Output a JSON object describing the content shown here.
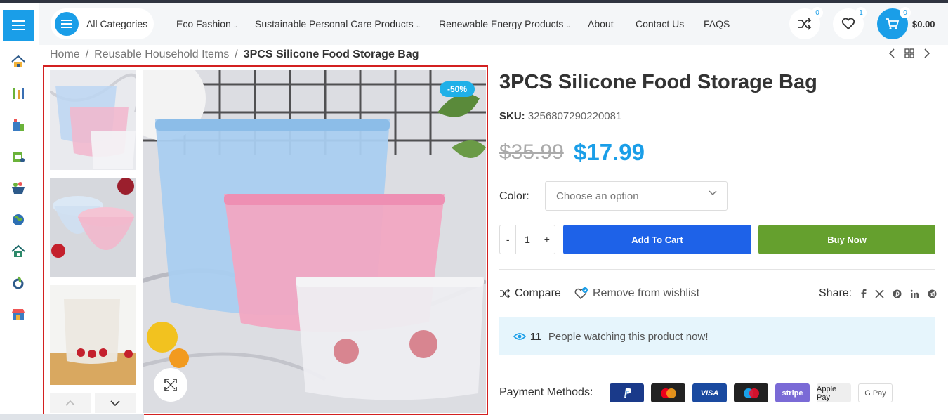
{
  "header": {
    "all_categories": "All Categories",
    "nav": [
      {
        "label": "Eco Fashion",
        "dropdown": true
      },
      {
        "label": "Sustainable Personal Care Products",
        "dropdown": true
      },
      {
        "label": "Renewable Energy Products",
        "dropdown": true
      },
      {
        "label": "About",
        "dropdown": false
      },
      {
        "label": "Contact Us",
        "dropdown": false
      },
      {
        "label": "FAQS",
        "dropdown": false
      }
    ],
    "compare_count": "0",
    "wishlist_count": "1",
    "cart_count": "0",
    "cart_total": "$0.00"
  },
  "sidebar_icons": [
    "home-icon",
    "kitchen-tools-icon",
    "building-icon",
    "shop-tag-icon",
    "shopping-basket-icon",
    "globe-icon",
    "house-icon",
    "plant-gear-icon",
    "store-icon"
  ],
  "breadcrumb": {
    "home": "Home",
    "category": "Reusable Household Items",
    "current": "3PCS Silicone Food Storage Bag"
  },
  "gallery": {
    "sale_badge": "-50%"
  },
  "product": {
    "title": "3PCS Silicone Food Storage Bag",
    "sku_label": "SKU:",
    "sku": "3256807290220081",
    "price_old": "$35.99",
    "price_new": "$17.99",
    "color_label": "Color",
    "color_placeholder": "Choose an option",
    "qty_minus": "-",
    "qty_value": "1",
    "qty_plus": "+",
    "add_to_cart": "Add To Cart",
    "buy_now": "Buy Now",
    "compare": "Compare",
    "wishlist": "Remove from wishlist",
    "share": "Share:",
    "watch_count": "11",
    "watch_text": "People watching this product now!",
    "payment_label": "Payment Methods:",
    "payment_methods": [
      "PayPal",
      "Mastercard",
      "VISA",
      "Maestro",
      "stripe",
      "Apple Pay",
      "G Pay"
    ]
  },
  "colors": {
    "accent": "#1a9ee8",
    "add_to_cart": "#1e62e8",
    "buy_now": "#65a02e",
    "sale": "#1fb0e8"
  }
}
